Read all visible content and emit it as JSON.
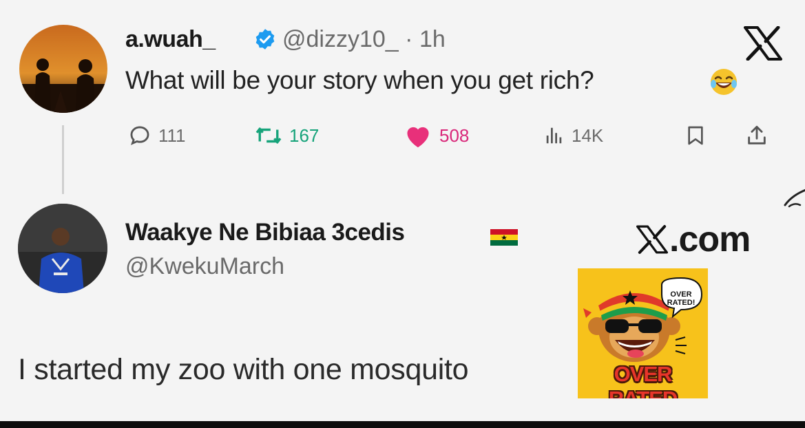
{
  "tweet": {
    "author_name": "a.wuah_",
    "handle": "@dizzy10_",
    "separator": "·",
    "time": "1h",
    "text": "What will be your story when you get rich?",
    "emoji": "rolling-on-floor-laughing-icon",
    "stats": {
      "replies": "111",
      "reposts": "167",
      "likes": "508",
      "views": "14K"
    },
    "colors": {
      "repost": "#16a37a",
      "like": "#e8307a",
      "verified": "#1d9bf0"
    }
  },
  "reply": {
    "author_name": "Waakye Ne Bibiaa 3cedis",
    "flag": "ghana-flag-icon",
    "handle": "@KwekuMarch",
    "text": "I started my zoo with one mosquito"
  },
  "watermark": {
    "text": ".com"
  },
  "sticker": {
    "bubble_text": "OVER RATED!",
    "label": "OVER RATED",
    "background": "#f7c21b"
  }
}
